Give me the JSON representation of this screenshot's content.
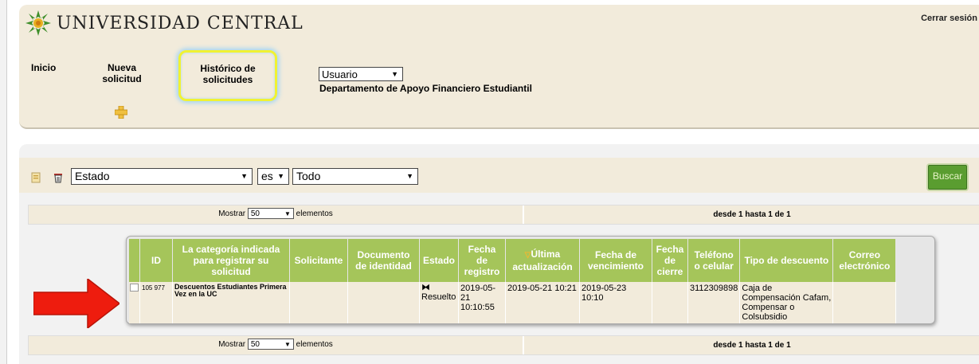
{
  "header": {
    "logo_text": "UNIVERSIDAD CENTRAL",
    "logout": "Cerrar sesión",
    "nav": {
      "inicio": "Inicio",
      "nueva": "Nueva solicitud",
      "historico": "Histórico de solicitudes"
    },
    "role_select": "Usuario",
    "department": "Departamento de Apoyo Financiero Estudiantil"
  },
  "filter": {
    "field": "Estado",
    "operator": "es",
    "value": "Todo",
    "search_button": "Buscar"
  },
  "pager": {
    "show_label": "Mostrar",
    "page_size": "50",
    "elements_label": "elementos",
    "range": "desde 1 hasta 1 de 1"
  },
  "table": {
    "columns": [
      "ID",
      "La categoría indicada para registrar su solicitud",
      "Solicitante",
      "Documento de identidad",
      "Estado",
      "Fecha de registro",
      "Última actualización",
      "Fecha de vencimiento",
      "Fecha de cierre",
      "Teléfono o celular",
      "Tipo de descuento",
      "Correo electrónico"
    ],
    "rows": [
      {
        "id": "105 977",
        "category": "Descuentos Estudiantes Primera Vez en la UC",
        "solicitante": "",
        "documento": "",
        "estado": "Resuelto",
        "fecha_registro": "2019-05-21 10:10:55",
        "ultima_actualizacion": "2019-05-21 10:21",
        "fecha_vencimiento": "2019-05-23 10:10",
        "fecha_cierre": "",
        "telefono": "3112309898",
        "tipo_descuento": "Caja de Compensación Cafam, Compensar o Colsubsidio",
        "correo": ""
      }
    ]
  },
  "colors": {
    "header_bg": "#f2ebdb",
    "table_header": "#a5c55a",
    "button_green": "#5a9d30",
    "highlight_yellow": "#f0f232",
    "arrow_red": "#ee1c0e"
  }
}
